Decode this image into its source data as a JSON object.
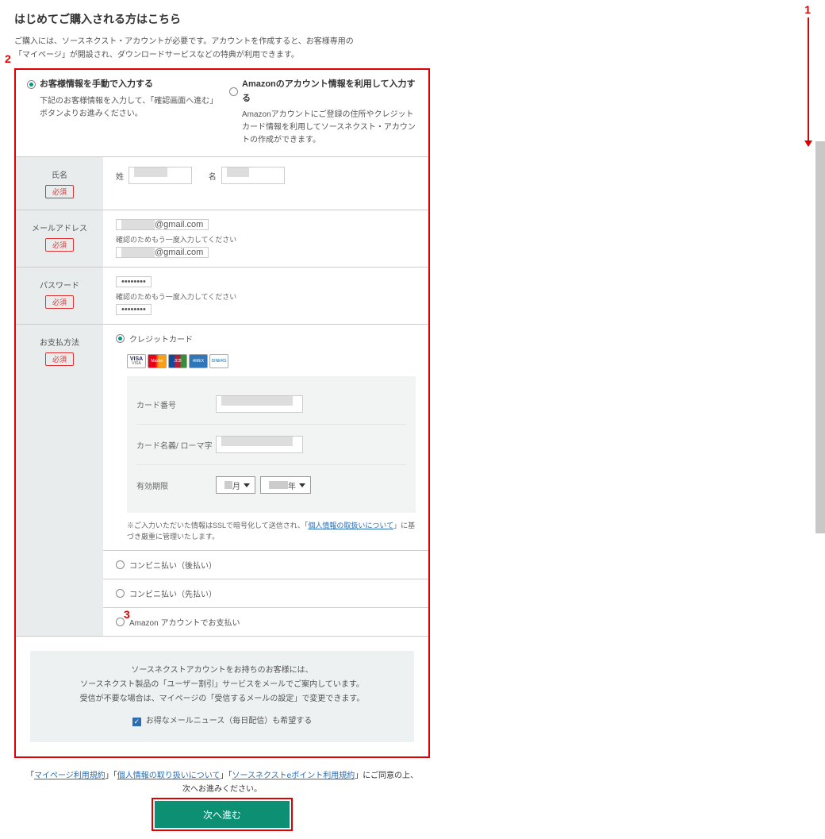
{
  "header": {
    "title": "はじめてご購入される方はこちら",
    "intro_l1": "ご購入には、ソースネクスト・アカウントが必要です。アカウントを作成すると、お客様専用の",
    "intro_l2": "「マイページ」が開設され、ダウンロードサービスなどの特典が利用できます。"
  },
  "method": {
    "manual_title": "お客様情報を手動で入力する",
    "manual_desc": "下記のお客様情報を入力して、「確認画面へ進む」ボタンよりお進みください。",
    "amazon_title": "Amazonのアカウント情報を利用して入力する",
    "amazon_desc": "Amazonアカウントにご登録の住所やクレジットカード情報を利用してソースネクスト・アカウントの作成ができます。"
  },
  "labels": {
    "name": "氏名",
    "email": "メールアドレス",
    "password": "パスワード",
    "payment": "お支払方法",
    "required": "必須",
    "sei": "姓",
    "mei": "名",
    "confirm_hint": "確認のためもう一度入力してください",
    "card_number": "カード番号",
    "card_name": "カード名義/ ローマ字",
    "expiry": "有効期限",
    "month": "月",
    "year": "年"
  },
  "card_brands": {
    "visa": "VISA",
    "mc": "Master",
    "jcb": "JCB",
    "amex": "AMEX",
    "diners": "DINERS"
  },
  "values": {
    "email_suffix": "@gmail.com",
    "password_mask": "••••••••"
  },
  "payment_options": {
    "credit": "クレジットカード",
    "konbini_after": "コンビニ払い（後払い）",
    "konbini_before": "コンビニ払い（先払い）",
    "amazon": "Amazon アカウントでお支払い"
  },
  "ssl_note": {
    "pre": "※ご入力いただいた情報はSSLで暗号化して送信され、「",
    "link": "個人情報の取扱いについて",
    "post": "」に基づき厳重に管理いたします。"
  },
  "promo": {
    "l1": "ソースネクストアカウントをお持ちのお客様には、",
    "l2": "ソースネクスト製品の「ユーザー割引」サービスをメールでご案内しています。",
    "l3": "受信が不要な場合は、マイページの「受信するメールの設定」で変更できます。",
    "checkbox": "お得なメールニュース（毎日配信）も希望する"
  },
  "agree": {
    "l1_a": "「",
    "link1": "マイページ利用規約",
    "l1_b": "」「",
    "link2": "個人情報の取り扱いについて",
    "l1_c": "」「",
    "link3": "ソースネクストeポイント利用規約",
    "l1_d": "」にご同意の上、",
    "l2": "次へお進みください。"
  },
  "submit": "次へ進む",
  "callouts": {
    "one": "1",
    "two": "2",
    "three": "3"
  }
}
